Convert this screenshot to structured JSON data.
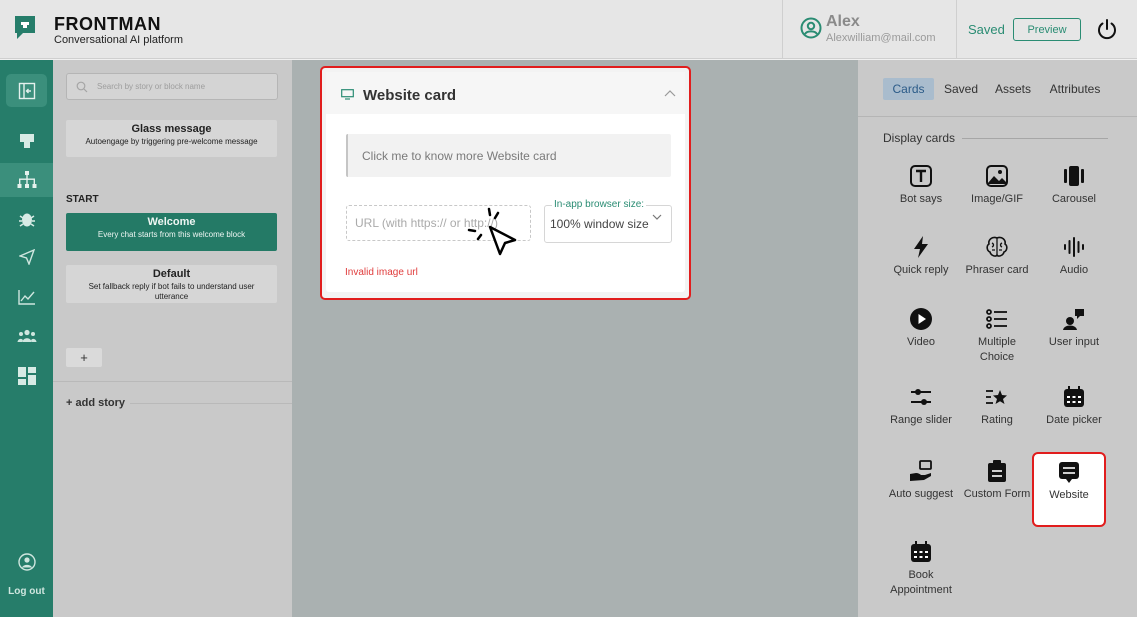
{
  "header": {
    "brand_name": "FRONTMAN",
    "brand_tagline": "Conversational AI platform",
    "user_name": "Alex",
    "user_email": "Alexwilliam@mail.com",
    "save_status": "Saved",
    "preview_label": "Preview"
  },
  "sidebar": {
    "items": [
      "collapse-icon",
      "inbox-icon",
      "flow-icon",
      "bug-icon",
      "broadcast-icon",
      "analytics-icon",
      "team-icon",
      "dashboard-icon"
    ],
    "logout_label": "Log out"
  },
  "story_panel": {
    "search_placeholder": "Search by story or block name",
    "glass_title": "Glass message",
    "glass_desc": "Autoengage by triggering pre-welcome message",
    "start_label": "START",
    "welcome_title": "Welcome",
    "welcome_desc": "Every chat starts from this welcome block",
    "default_title": "Default",
    "default_desc": "Set fallback reply if bot fails to understand user utterance",
    "plus_label": "+",
    "add_story_label": "+ add story"
  },
  "card": {
    "title": "Website card",
    "description_placeholder": "Click me to know more Website card",
    "url_placeholder": "URL (with https:// or http://)",
    "size_label": "In-app browser size:",
    "size_value": "100% window size",
    "error": "Invalid image url"
  },
  "right_panel": {
    "tabs": [
      {
        "label": "Cards",
        "active": true
      },
      {
        "label": "Saved",
        "active": false
      },
      {
        "label": "Assets",
        "active": false
      },
      {
        "label": "Attributes",
        "active": false
      }
    ],
    "section_label": "Display cards",
    "cards": [
      {
        "label": "Bot says",
        "icon": "text-icon"
      },
      {
        "label": "Image/GIF",
        "icon": "image-icon"
      },
      {
        "label": "Carousel",
        "icon": "carousel-icon"
      },
      {
        "label": "Quick reply",
        "icon": "bolt-icon"
      },
      {
        "label": "Phraser card",
        "icon": "brain-icon"
      },
      {
        "label": "Audio",
        "icon": "audio-icon"
      },
      {
        "label": "Video",
        "icon": "play-icon"
      },
      {
        "label": "Multiple Choice",
        "icon": "list-icon"
      },
      {
        "label": "User input",
        "icon": "user-input-icon"
      },
      {
        "label": "Range slider",
        "icon": "slider-icon"
      },
      {
        "label": "Rating",
        "icon": "star-icon"
      },
      {
        "label": "Date picker",
        "icon": "calendar-icon"
      },
      {
        "label": "Auto suggest",
        "icon": "hand-icon"
      },
      {
        "label": "Custom Form",
        "icon": "clipboard-icon"
      },
      {
        "label": "Website",
        "icon": "website-icon"
      },
      {
        "label": "Book Appointment",
        "icon": "calendar-icon"
      }
    ]
  },
  "colors": {
    "brand": "#267d6a",
    "accent": "#2a8c73",
    "highlight": "#e11d1d",
    "error": "#e03c3c"
  }
}
